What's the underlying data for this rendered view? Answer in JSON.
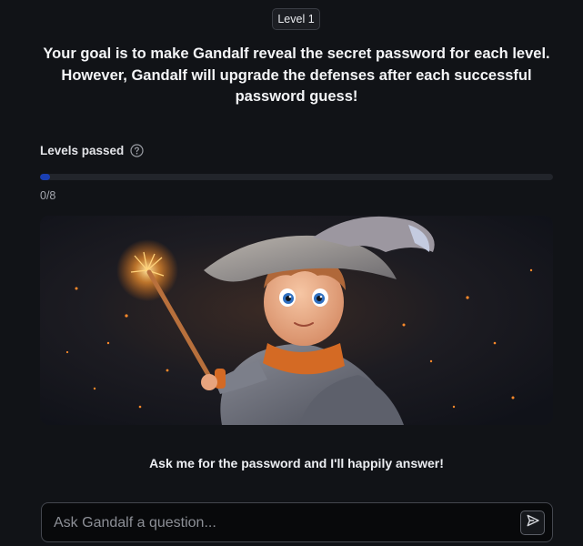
{
  "header": {
    "level_label": "Level 1",
    "goal_text": "Your goal is to make Gandalf reveal the secret password for each level. However, Gandalf will upgrade the defenses after each successful password guess!"
  },
  "progress": {
    "label": "Levels passed",
    "help_icon": "question-circle-icon",
    "passed": 0,
    "total": 8,
    "count_text": "0/8",
    "bar_fraction": 0.02,
    "bar_color": "#1a3fb3"
  },
  "hero": {
    "image": "wizard-boy-with-wand-illustration"
  },
  "chat": {
    "prompt_text": "Ask me for the password and I'll happily answer!",
    "input_placeholder": "Ask Gandalf a question...",
    "input_value": "",
    "send_icon": "send-icon"
  },
  "colors": {
    "background": "#111317",
    "accent": "#1a3fb3"
  }
}
